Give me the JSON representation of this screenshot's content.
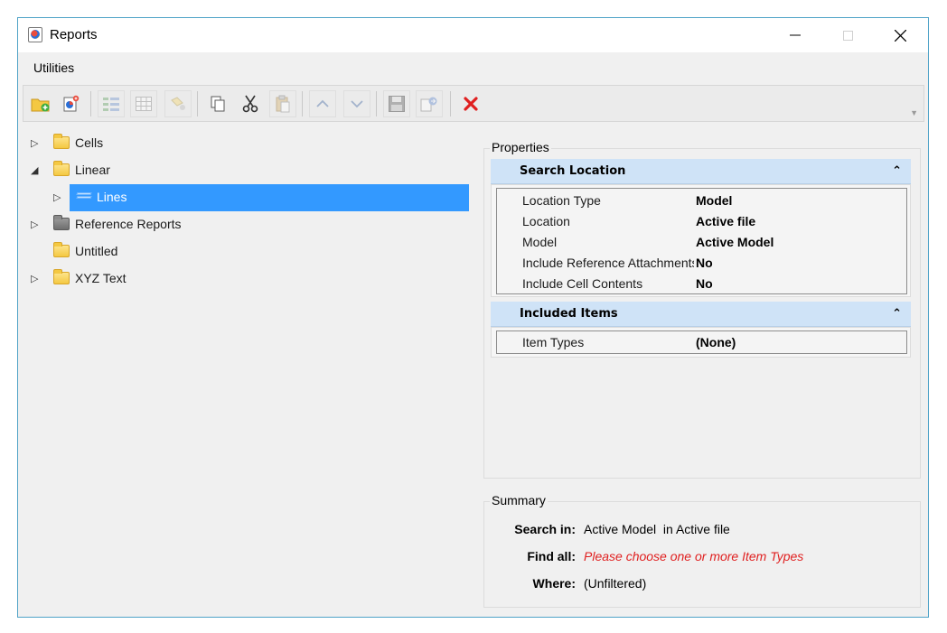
{
  "window": {
    "title": "Reports"
  },
  "menu": {
    "items": [
      "Utilities"
    ]
  },
  "toolbar": {
    "buttons": [
      {
        "icon": "new-folder-icon"
      },
      {
        "icon": "new-report-icon"
      },
      {
        "icon": "columns-icon"
      },
      {
        "icon": "grid-icon"
      },
      {
        "icon": "format-icon"
      },
      {
        "icon": "copy-icon"
      },
      {
        "icon": "cut-icon"
      },
      {
        "icon": "paste-icon"
      },
      {
        "icon": "move-up-icon"
      },
      {
        "icon": "move-down-icon"
      },
      {
        "icon": "save-icon"
      },
      {
        "icon": "export-icon"
      },
      {
        "icon": "delete-icon"
      }
    ],
    "delete_color": "#e02020"
  },
  "tree": {
    "items": [
      {
        "label": "Cells",
        "expandable": true,
        "expanded": false
      },
      {
        "label": "Linear",
        "expandable": true,
        "expanded": true
      },
      {
        "label": "Lines",
        "expandable": true,
        "expanded": false,
        "selected": true
      },
      {
        "label": "Reference Reports",
        "expandable": true,
        "expanded": false
      },
      {
        "label": "Untitled",
        "expandable": false
      },
      {
        "label": "XYZ Text",
        "expandable": true,
        "expanded": false
      }
    ],
    "selection_color": "#3399ff"
  },
  "properties": {
    "title": "Properties",
    "sections": [
      {
        "header": "Search Location",
        "rows": [
          {
            "name": "Location Type",
            "value": "Model"
          },
          {
            "name": "Location",
            "value": "Active file"
          },
          {
            "name": "Model",
            "value": "Active Model"
          },
          {
            "name": "Include Reference Attachments",
            "value": "No"
          },
          {
            "name": "Include Cell Contents",
            "value": "No"
          }
        ]
      },
      {
        "header": "Included Items",
        "rows": [
          {
            "name": "Item Types",
            "value": "(None)"
          }
        ]
      }
    ],
    "header_color": "#cfe3f7"
  },
  "summary": {
    "title": "Summary",
    "rows": [
      {
        "key": "Search in:",
        "value": "Active Model  in Active file"
      },
      {
        "key": "Find all:",
        "value": "Please choose one or more Item Types",
        "warning": true
      },
      {
        "key": "Where:",
        "value": "(Unfiltered)"
      }
    ],
    "warning_color": "#e02020"
  }
}
